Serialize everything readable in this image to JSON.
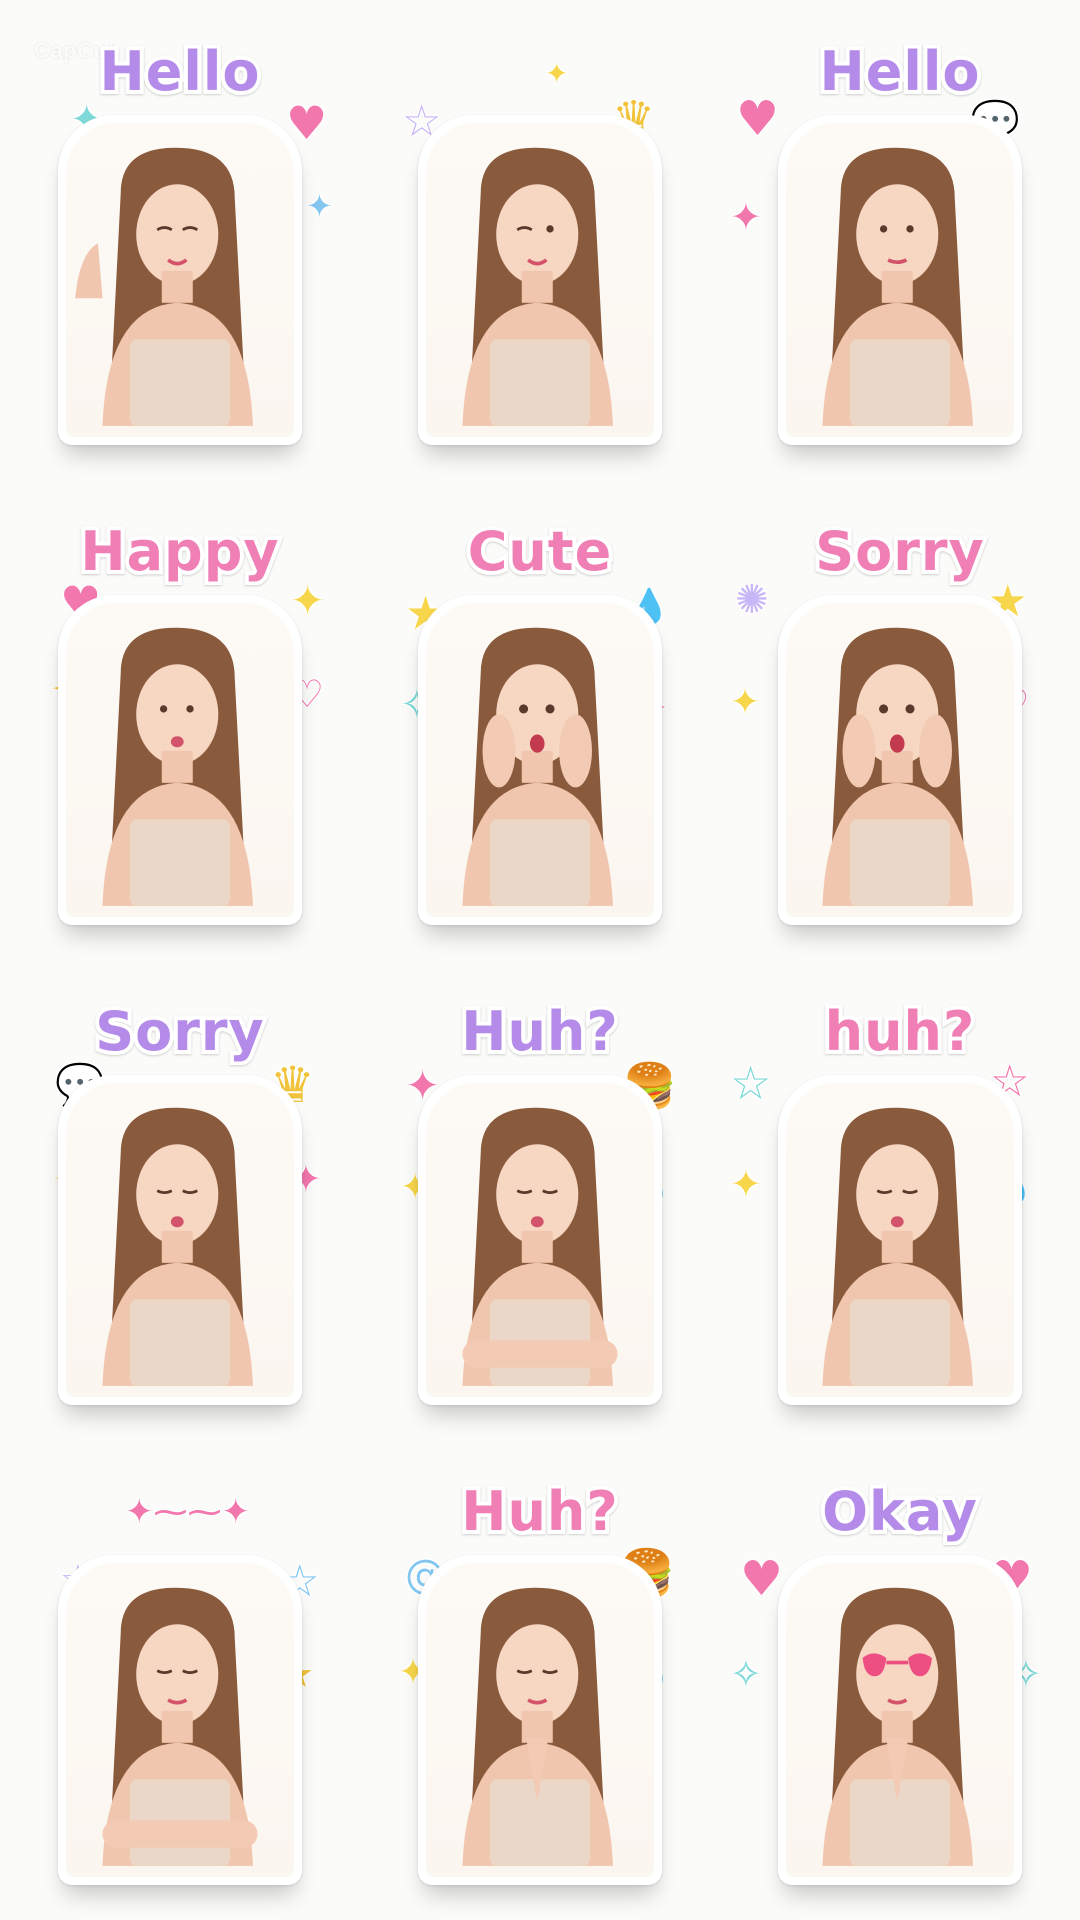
{
  "watermark": "CapCut",
  "colors": {
    "caption_purple": "#b48be8",
    "caption_pink": "#ef7fb4",
    "sticker_border": "#ffffff",
    "background": "#fbfbf9"
  },
  "stickers": [
    {
      "caption": "Hello",
      "caption_color": "#b48be8",
      "pose": "waving-and-thumbs-up",
      "decorations": [
        "sparkle-icon",
        "heart-icon",
        "sparkle-icon"
      ]
    },
    {
      "caption": "",
      "caption_color": "#b48be8",
      "pose": "winking-smile",
      "decorations": [
        "star-icon",
        "sparkle-icon",
        "crown-icon",
        "sparkle-icon"
      ]
    },
    {
      "caption": "Hello",
      "caption_color": "#b48be8",
      "pose": "gentle-smile",
      "decorations": [
        "heart-icon",
        "speech-bubble-icon",
        "sparkle-icon",
        "star-icon"
      ]
    },
    {
      "caption": "Happy",
      "caption_color": "#ef7fb4",
      "pose": "pouting-kiss",
      "decorations": [
        "heart-icon",
        "sparkle-icon",
        "sparkle-icon",
        "heart-icon"
      ]
    },
    {
      "caption": "Cute",
      "caption_color": "#ef7fb4",
      "pose": "surprised-hands-on-cheeks",
      "decorations": [
        "star-icon",
        "sweat-drops-icon",
        "sparkle-icon",
        "star-icon"
      ]
    },
    {
      "caption": "Sorry",
      "caption_color": "#ef7fb4",
      "pose": "surprised-hands-on-cheeks",
      "decorations": [
        "burst-icon",
        "star-icon",
        "sparkle-icon",
        "heart-icon"
      ]
    },
    {
      "caption": "Sorry",
      "caption_color": "#b48be8",
      "pose": "eyes-closed-pout",
      "decorations": [
        "speech-bubble-icon",
        "crown-icon",
        "sparkle-icon",
        "sparkle-icon"
      ]
    },
    {
      "caption": "Huh?",
      "caption_color": "#b48be8",
      "pose": "arms-crossed-pout",
      "decorations": [
        "sparkle-icon",
        "burger-icon",
        "sparkle-icon",
        "sweat-drops-icon"
      ]
    },
    {
      "caption": "huh?",
      "caption_color": "#ef7fb4",
      "pose": "eyes-closed-pout",
      "decorations": [
        "star-icon",
        "star-icon",
        "sparkle-icon",
        "sweat-drops-icon"
      ]
    },
    {
      "caption": "",
      "caption_color": "#b48be8",
      "pose": "arms-crossed-smile",
      "decorations": [
        "sparkle-line-icon",
        "star-icon",
        "star-icon",
        "sparkle-icon"
      ]
    },
    {
      "caption": "Huh?",
      "caption_color": "#ef7fb4",
      "pose": "hands-pressed-together",
      "decorations": [
        "swirl-icon",
        "burger-icon",
        "sparkle-icon",
        "sweat-drops-icon"
      ]
    },
    {
      "caption": "Okay",
      "caption_color": "#b48be8",
      "pose": "heart-sunglasses-hands-pressed",
      "decorations": [
        "heart-icon",
        "heart-icon",
        "sparkle-icon",
        "sparkle-icon"
      ]
    }
  ]
}
